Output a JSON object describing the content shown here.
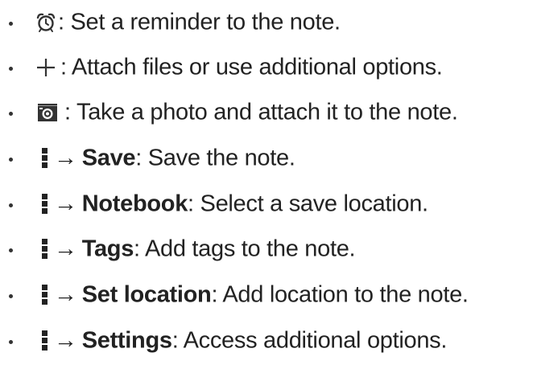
{
  "items": [
    {
      "icon": "alarm-clock-icon",
      "prefix": "",
      "bold": "",
      "text": ": Set a reminder to the note."
    },
    {
      "icon": "plus-icon",
      "prefix": "",
      "bold": "",
      "text": ": Attach files or use additional options."
    },
    {
      "icon": "camera-icon",
      "prefix": "",
      "bold": "",
      "text": ": Take a photo and attach it to the note."
    },
    {
      "icon": "more-options-icon",
      "prefix": "→",
      "bold": "Save",
      "text": ": Save the note."
    },
    {
      "icon": "more-options-icon",
      "prefix": "→",
      "bold": "Notebook",
      "text": ": Select a save location."
    },
    {
      "icon": "more-options-icon",
      "prefix": "→",
      "bold": "Tags",
      "text": ": Add tags to the note."
    },
    {
      "icon": "more-options-icon",
      "prefix": "→",
      "bold": "Set location",
      "text": ": Add location to the note."
    },
    {
      "icon": "more-options-icon",
      "prefix": "→",
      "bold": "Settings",
      "text": ": Access additional options."
    }
  ]
}
